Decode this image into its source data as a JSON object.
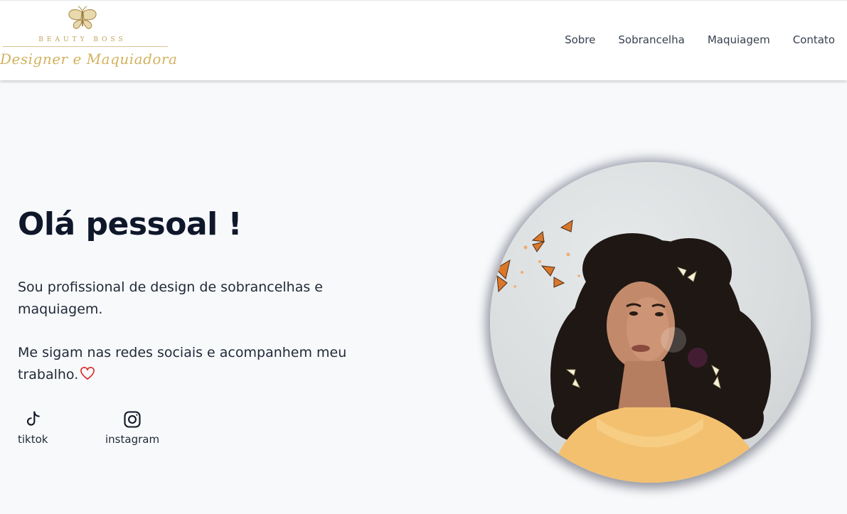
{
  "header": {
    "logo": {
      "brand": "BEAUTY BOSS",
      "subtitle": "Designer e Maquiadora",
      "icon": "butterfly-icon"
    },
    "nav": [
      {
        "label": "Sobre"
      },
      {
        "label": "Sobrancelha"
      },
      {
        "label": "Maquiagem"
      },
      {
        "label": "Contato"
      }
    ]
  },
  "hero": {
    "title": "Olá pessoal !",
    "paragraph_1": "Sou profissional de design de sobrancelhas e maquiagem.",
    "paragraph_2": "Me sigam nas redes sociais e acompanhem meu trabalho.",
    "heart_icon": "heart-icon",
    "heart_color": "#dc2626"
  },
  "social": [
    {
      "label": "tiktok",
      "icon": "tiktok-icon"
    },
    {
      "label": "instagram",
      "icon": "instagram-icon"
    }
  ],
  "colors": {
    "gold": "#c9a961",
    "text_dark": "#0f172a",
    "background": "#f8f9fb"
  }
}
